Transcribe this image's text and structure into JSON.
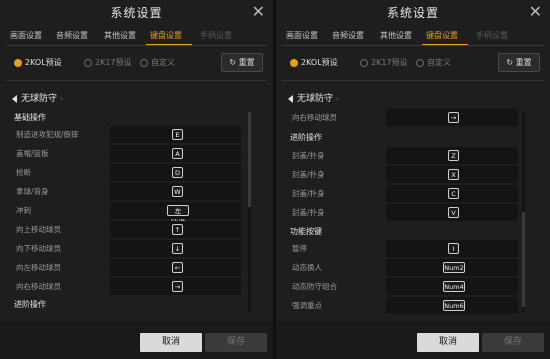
{
  "title": "系统设置",
  "tabs": [
    "画面设置",
    "音频设置",
    "其他设置",
    "键盘设置",
    "手柄设置"
  ],
  "presets": [
    "2KOL预设",
    "2K17预设",
    "自定义"
  ],
  "reset_label": "重置",
  "section_title": "无球防守",
  "footer": {
    "cancel": "取消",
    "save": "保存"
  },
  "left_rows": [
    {
      "label": "基础操作",
      "header": true
    },
    {
      "label": "制造进攻犯规/假摔",
      "key": "E"
    },
    {
      "label": "盖帽/篮板",
      "key": "A"
    },
    {
      "label": "抢断",
      "key": "D"
    },
    {
      "label": "拿球/背身",
      "key": "W"
    },
    {
      "label": "冲刺",
      "key": "左Shift"
    },
    {
      "label": "向上移动球员",
      "key": "↑"
    },
    {
      "label": "向下移动球员",
      "key": "↓"
    },
    {
      "label": "向左移动球员",
      "key": "←"
    },
    {
      "label": "向右移动球员",
      "key": "→"
    },
    {
      "label": "进阶操作",
      "header": true
    }
  ],
  "right_rows": [
    {
      "label": "向右移动球员",
      "key": "→"
    },
    {
      "label": "进阶操作",
      "header": true
    },
    {
      "label": "封盖/扑身",
      "key": "Z"
    },
    {
      "label": "封盖/扑身",
      "key": "X"
    },
    {
      "label": "封盖/扑身",
      "key": "C"
    },
    {
      "label": "封盖/扑身",
      "key": "V"
    },
    {
      "label": "功能按键",
      "header": true
    },
    {
      "label": "暂停",
      "key": "I"
    },
    {
      "label": "动态换人",
      "key": "Num2"
    },
    {
      "label": "动态防守组合",
      "key": "Num4"
    },
    {
      "label": "强调重点",
      "key": "Num6"
    }
  ],
  "colors": {
    "accent": "#e8a11a",
    "background": "#1e1e1e"
  },
  "icons": {
    "close": "close-icon",
    "reset": "refresh-icon",
    "collapse": "caret-left-icon"
  }
}
